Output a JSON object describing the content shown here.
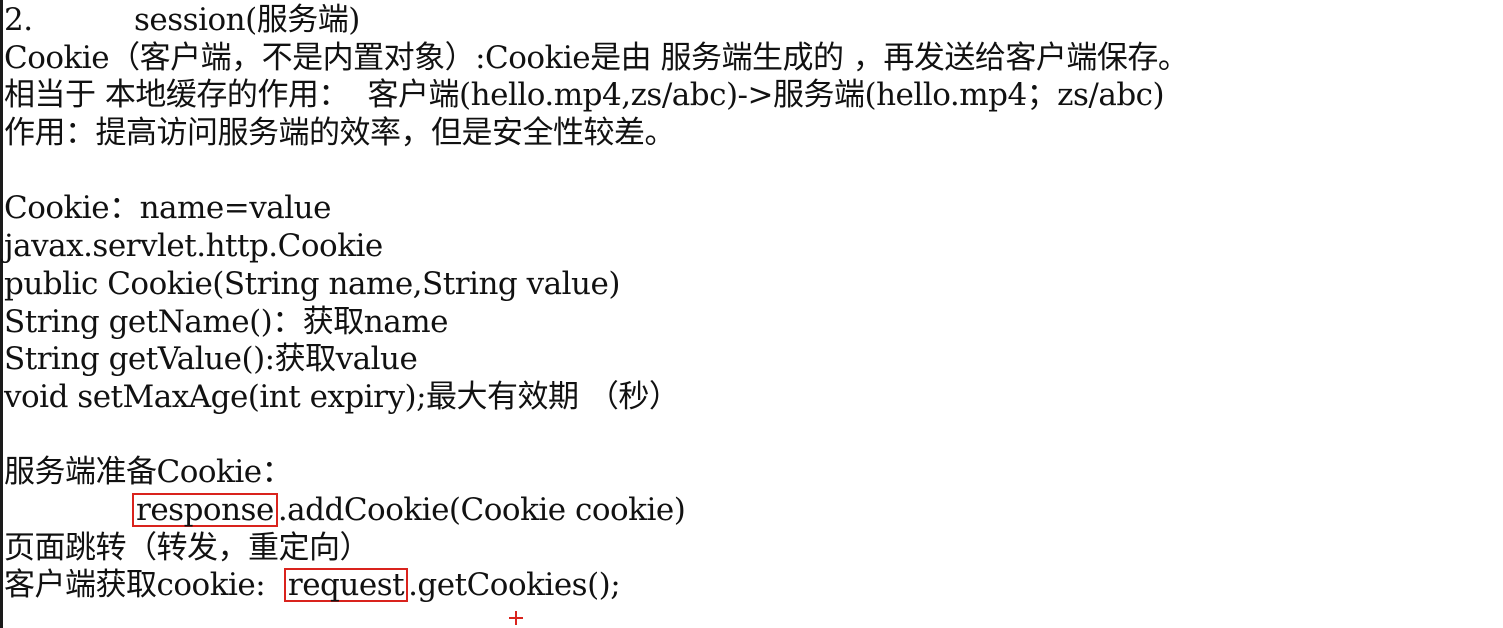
{
  "lines": {
    "l1_num": "2.",
    "l1_text": "session(服务端)",
    "l2": "Cookie（客户端，不是内置对象）:Cookie是由 服务端生成的 ，再发送给客户端保存。",
    "l3": "相当于 本地缓存的作用：  客户端(hello.mp4,zs/abc)->服务端(hello.mp4；zs/abc)",
    "l4": "作用：提高访问服务端的效率，但是安全性较差。",
    "l6": "Cookie：name=value",
    "l7": "javax.servlet.http.Cookie",
    "l8": "public Cookie(String name,String value)",
    "l9": "String getName()：获取name",
    "l10": "String getValue():获取value",
    "l11": "void setMaxAge(int expiry);最大有效期 （秒）",
    "l13": "服务端准备Cookie：",
    "l14_boxed": "response",
    "l14_rest": ".addCookie(Cookie cookie)",
    "l15": "页面跳转（转发，重定向）",
    "l16_prefix": "客户端获取cookie:  ",
    "l16_boxed": "request",
    "l16_rest": ".getCookies();"
  },
  "colors": {
    "highlight_box": "#d9231d",
    "text": "#111111",
    "background": "#ffffff"
  }
}
